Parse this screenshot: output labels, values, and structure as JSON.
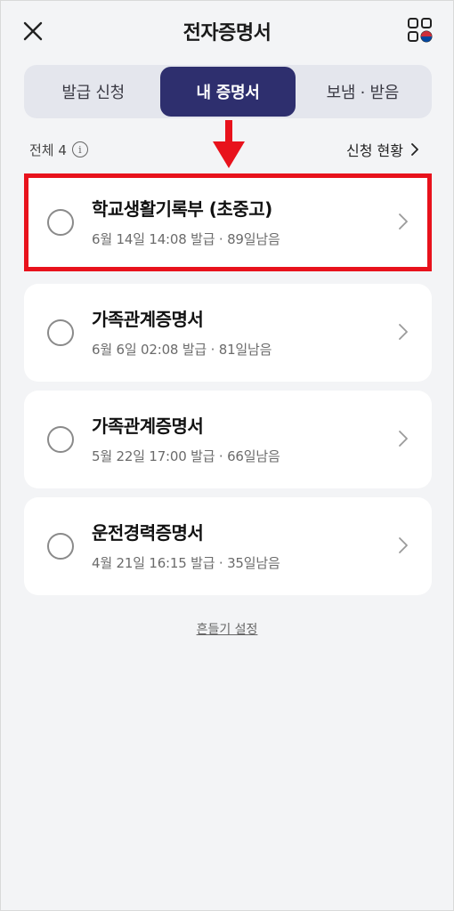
{
  "header": {
    "title": "전자증명서",
    "close_icon": "close-icon",
    "apps_icon": "apps-grid-icon"
  },
  "tabs": [
    {
      "label": "발급 신청",
      "active": false
    },
    {
      "label": "내 증명서",
      "active": true
    },
    {
      "label": "보냄 · 받음",
      "active": false
    }
  ],
  "summary": {
    "total_label": "전체 4",
    "status_link": "신청 현황"
  },
  "certificates": [
    {
      "title": "학교생활기록부 (초중고)",
      "subtitle": "6월 14일 14:08 발급 · 89일남음",
      "highlighted": true
    },
    {
      "title": "가족관계증명서",
      "subtitle": "6월 6일 02:08 발급 · 81일남음",
      "highlighted": false
    },
    {
      "title": "가족관계증명서",
      "subtitle": "5월 22일 17:00 발급 · 66일남음",
      "highlighted": false
    },
    {
      "title": "운전경력증명서",
      "subtitle": "4월 21일 16:15 발급 · 35일남음",
      "highlighted": false
    }
  ],
  "footer": {
    "shake_setting": "흔들기 설정"
  },
  "colors": {
    "accent": "#2e2f6e",
    "highlight": "#e8121c",
    "background": "#f3f4f6"
  }
}
